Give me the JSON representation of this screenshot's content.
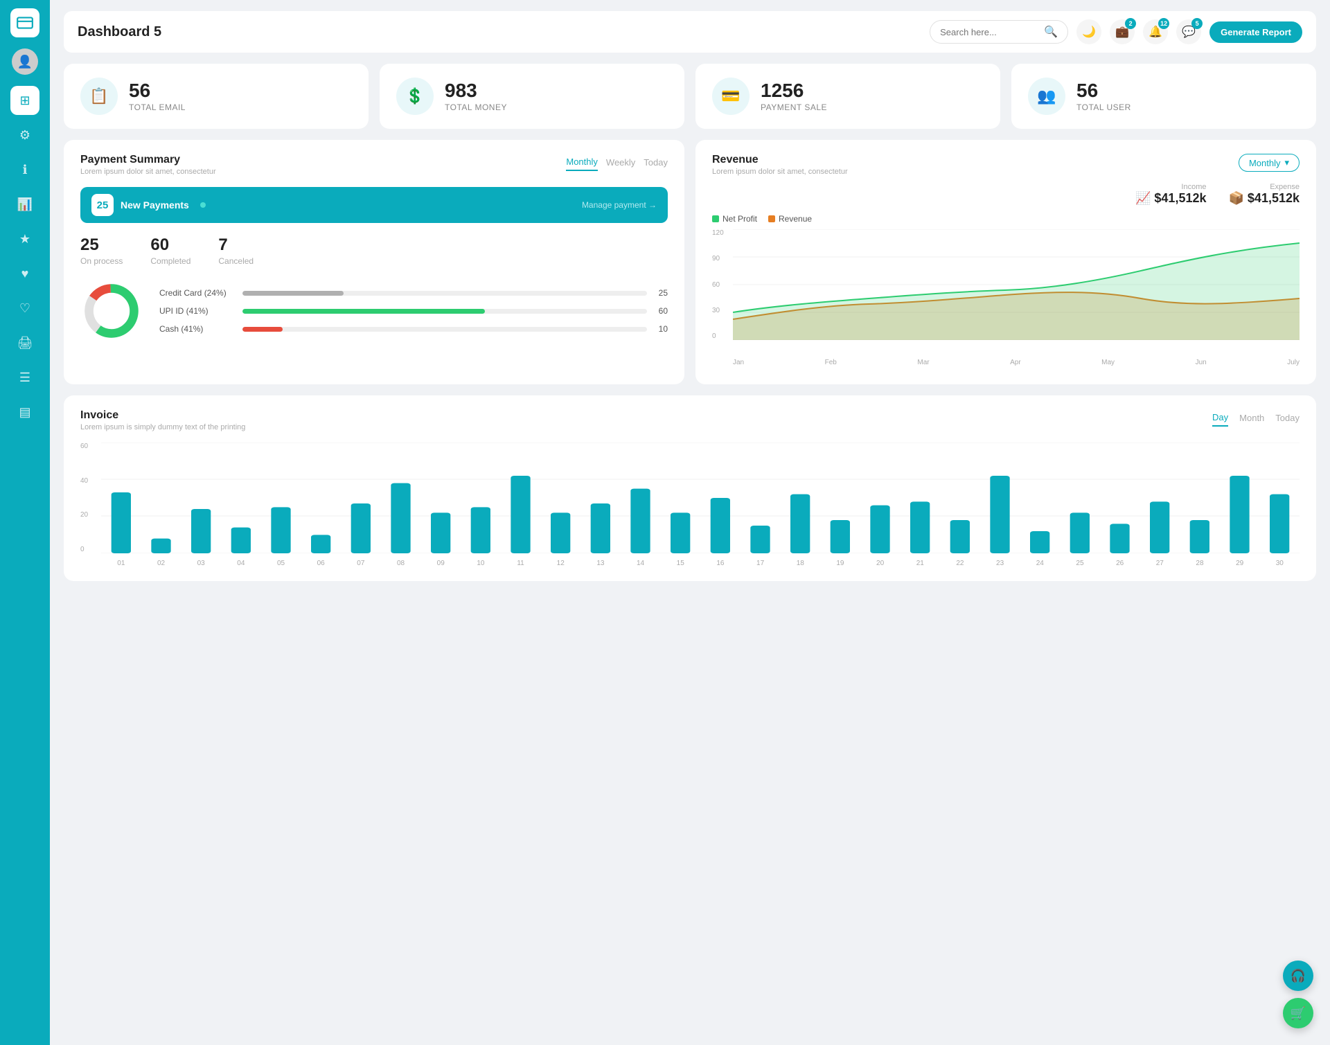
{
  "app": {
    "title": "Dashboard 5"
  },
  "header": {
    "search_placeholder": "Search here...",
    "generate_btn": "Generate Report",
    "badges": {
      "wallet": "2",
      "bell": "12",
      "chat": "5"
    }
  },
  "stats": [
    {
      "id": "email",
      "number": "56",
      "label": "TOTAL EMAIL",
      "icon": "📋"
    },
    {
      "id": "money",
      "number": "983",
      "label": "TOTAL MONEY",
      "icon": "💲"
    },
    {
      "id": "payment",
      "number": "1256",
      "label": "PAYMENT SALE",
      "icon": "💳"
    },
    {
      "id": "user",
      "number": "56",
      "label": "TOTAL USER",
      "icon": "👥"
    }
  ],
  "payment_summary": {
    "title": "Payment Summary",
    "subtitle": "Lorem ipsum dolor sit amet, consectetur",
    "tabs": [
      "Monthly",
      "Weekly",
      "Today"
    ],
    "active_tab": "Monthly",
    "new_payments_count": "25",
    "new_payments_label": "New Payments",
    "manage_link": "Manage payment →",
    "stats": [
      {
        "number": "25",
        "label": "On process"
      },
      {
        "number": "60",
        "label": "Completed"
      },
      {
        "number": "7",
        "label": "Canceled"
      }
    ],
    "progress_items": [
      {
        "label": "Credit Card (24%)",
        "value": 25,
        "color": "#b0b0b0",
        "display": "25"
      },
      {
        "label": "UPI ID (41%)",
        "value": 60,
        "color": "#2dcc70",
        "display": "60"
      },
      {
        "label": "Cash (41%)",
        "value": 10,
        "color": "#e74c3c",
        "display": "10"
      }
    ],
    "donut": {
      "segments": [
        {
          "label": "Completed",
          "percent": 60,
          "color": "#2dcc70"
        },
        {
          "label": "On process",
          "percent": 25,
          "color": "#e8e8e8"
        },
        {
          "label": "Canceled",
          "percent": 15,
          "color": "#e74c3c"
        }
      ]
    }
  },
  "revenue": {
    "title": "Revenue",
    "subtitle": "Lorem ipsum dolor sit amet, consectetur",
    "dropdown": "Monthly",
    "income": {
      "label": "Income",
      "amount": "$41,512k",
      "icon": "📈"
    },
    "expense": {
      "label": "Expense",
      "amount": "$41,512k",
      "icon": "📦"
    },
    "legend": [
      {
        "label": "Net Profit",
        "color": "#2dcc70"
      },
      {
        "label": "Revenue",
        "color": "#e67e22"
      }
    ],
    "x_labels": [
      "Jan",
      "Feb",
      "Mar",
      "Apr",
      "May",
      "Jun",
      "July"
    ],
    "y_labels": [
      "120",
      "90",
      "60",
      "30",
      "0"
    ]
  },
  "invoice": {
    "title": "Invoice",
    "subtitle": "Lorem ipsum is simply dummy text of the printing",
    "tabs": [
      "Day",
      "Month",
      "Today"
    ],
    "active_tab": "Day",
    "y_labels": [
      "60",
      "40",
      "20",
      "0"
    ],
    "x_labels": [
      "01",
      "02",
      "03",
      "04",
      "05",
      "06",
      "07",
      "08",
      "09",
      "10",
      "11",
      "12",
      "13",
      "14",
      "15",
      "16",
      "17",
      "18",
      "19",
      "20",
      "21",
      "22",
      "23",
      "24",
      "25",
      "26",
      "27",
      "28",
      "29",
      "30"
    ],
    "bars": [
      33,
      8,
      24,
      14,
      25,
      10,
      27,
      38,
      22,
      25,
      42,
      22,
      27,
      35,
      22,
      30,
      15,
      32,
      18,
      26,
      28,
      18,
      42,
      12,
      22,
      16,
      28,
      18,
      42,
      32
    ]
  },
  "sidebar": {
    "items": [
      {
        "id": "wallet",
        "icon": "💼",
        "active": false
      },
      {
        "id": "dashboard",
        "icon": "⊞",
        "active": true
      },
      {
        "id": "settings",
        "icon": "⚙",
        "active": false
      },
      {
        "id": "info",
        "icon": "ℹ",
        "active": false
      },
      {
        "id": "chart",
        "icon": "📊",
        "active": false
      },
      {
        "id": "star",
        "icon": "★",
        "active": false
      },
      {
        "id": "heart1",
        "icon": "♥",
        "active": false
      },
      {
        "id": "heart2",
        "icon": "♡",
        "active": false
      },
      {
        "id": "printer",
        "icon": "🖨",
        "active": false
      },
      {
        "id": "menu",
        "icon": "☰",
        "active": false
      },
      {
        "id": "list",
        "icon": "📋",
        "active": false
      }
    ]
  }
}
